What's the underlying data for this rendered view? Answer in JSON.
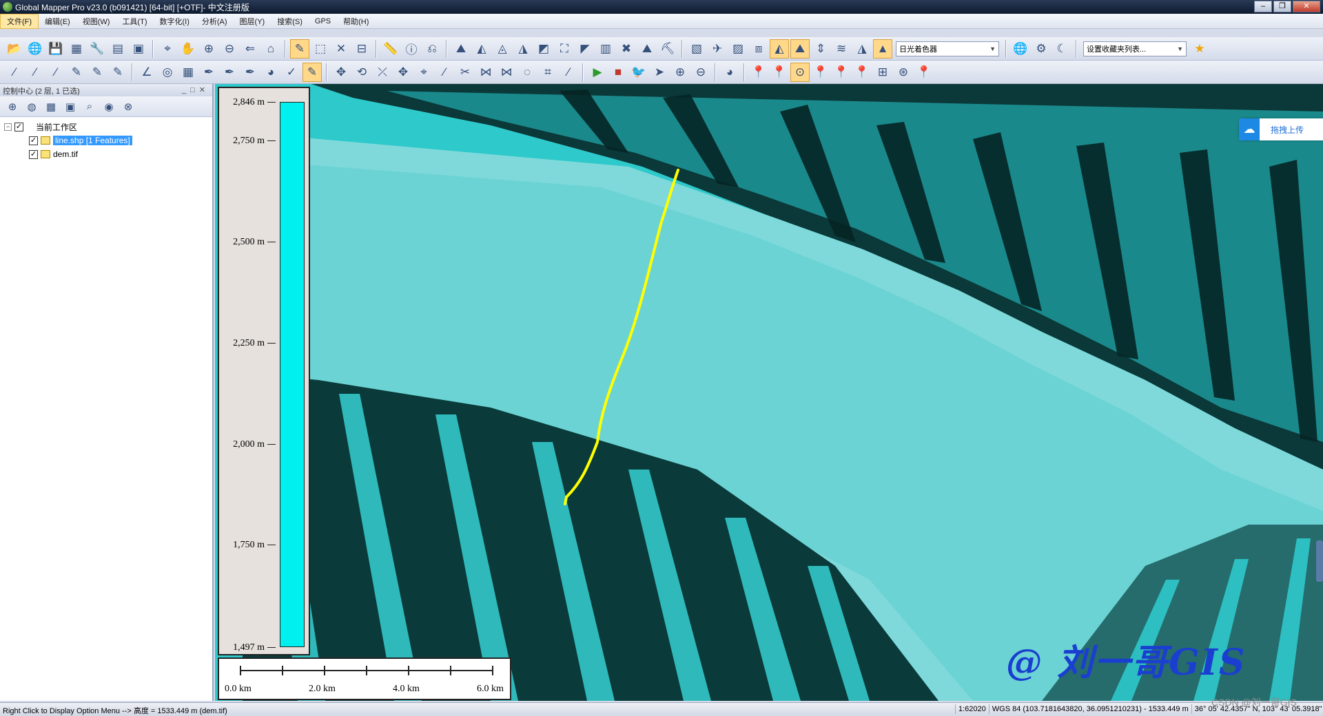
{
  "window": {
    "title": "Global Mapper Pro v23.0 (b091421) [64-bit] [+OTF]- 中文注册版",
    "buttons": [
      "–",
      "❐",
      "✕"
    ]
  },
  "menu": [
    "文件(F)",
    "编辑(E)",
    "视图(W)",
    "工具(T)",
    "数字化(I)",
    "分析(A)",
    "图层(Y)",
    "搜索(S)",
    "GPS",
    "帮助(H)"
  ],
  "toolbar": {
    "shader_select": "日光着色器",
    "favorites_select": "设置收藏夹列表..."
  },
  "control_center": {
    "title": "控制中心 (2 层, 1 已选)",
    "workspace_label": "当前工作区",
    "layers": [
      {
        "name": "line.shp [1 Features]",
        "checked": true,
        "selected": true
      },
      {
        "name": "dem.tif",
        "checked": true,
        "selected": false
      }
    ]
  },
  "elevation_legend": {
    "max": 2846,
    "min": 1497,
    "ticks": [
      {
        "value": 2846,
        "label": "2,846 m"
      },
      {
        "value": 2750,
        "label": "2,750 m"
      },
      {
        "value": 2500,
        "label": "2,500 m"
      },
      {
        "value": 2250,
        "label": "2,250 m"
      },
      {
        "value": 2000,
        "label": "2,000 m"
      },
      {
        "value": 1750,
        "label": "1,750 m"
      },
      {
        "value": 1497,
        "label": "1,497 m"
      }
    ],
    "color": "#00f0f0"
  },
  "scale_bar": {
    "labels": [
      "0.0 km",
      "2.0 km",
      "4.0 km",
      "6.0 km"
    ]
  },
  "map": {
    "line_color": "#ffff00",
    "terrain_color": "#33d6d6"
  },
  "upload_badge": {
    "label": "拖拽上传"
  },
  "watermark": "@ 刘一哥GIS",
  "status": {
    "message": "Right Click to Display Option Menu --> 高度 = 1533.449 m (dem.tif)",
    "scale": "1:62020",
    "coords": "WGS 84 (103.7181643820, 36.0951210231) - 1533.449 m",
    "dms": "36° 05' 42.4357\" N, 103° 43' 05.3918\" E"
  },
  "csdn_mark": "CSDN @刘一哥GIS"
}
